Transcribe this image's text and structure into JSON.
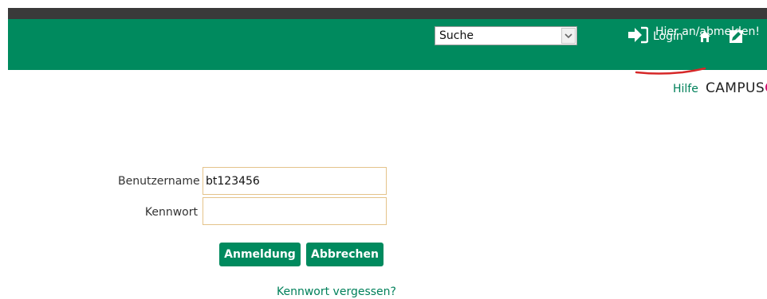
{
  "header": {
    "signin_link": "Hier an/abmelden!",
    "search_select": {
      "value": "Suche"
    },
    "login_label": "Login"
  },
  "help_link": "Hilfe",
  "logo_text": "CAMPUSO",
  "form": {
    "username_label": "Benutzername",
    "username_value": "bt123456",
    "password_label": "Kennwort",
    "password_value": "",
    "login_button": "Anmeldung",
    "cancel_button": "Abbrechen",
    "forgot_link": "Kennwort vergessen?"
  },
  "colors": {
    "brand_green": "#008a5e",
    "dark_bar": "#3a3a3a",
    "link_green": "#00805a",
    "input_border": "#e4c38a",
    "underline_red": "#d62828",
    "logo_accent": "#d4006a"
  },
  "icons": [
    "login-arrow-icon",
    "home-icon",
    "edit-icon",
    "chevron-down-icon"
  ]
}
